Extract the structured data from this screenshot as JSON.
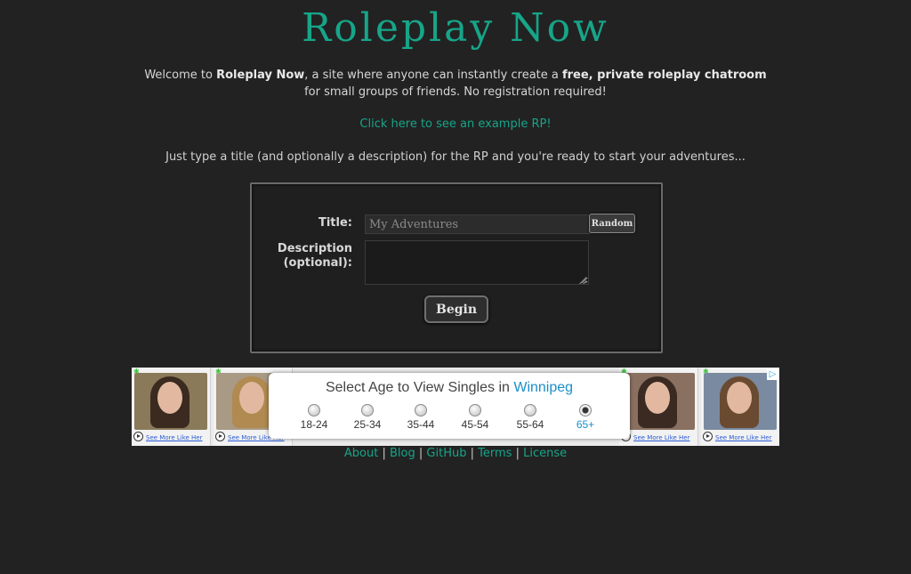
{
  "site": {
    "title": "Roleplay Now",
    "intro_part1": "Welcome to ",
    "intro_brand": "Roleplay Now",
    "intro_part2": ", a site where anyone can instantly create a ",
    "intro_bold": "free, private roleplay chatroom",
    "intro_line2": "for small groups of friends. No registration required!",
    "example_link": "Click here to see an example RP!",
    "instructions": "Just type a title (and optionally a description) for the RP and you're ready to start your adventures..."
  },
  "form": {
    "title_label": "Title:",
    "title_placeholder": "My Adventures",
    "title_value": "",
    "random_button": "Random",
    "description_label_line1": "Description",
    "description_label_line2": "(optional):",
    "description_value": "",
    "begin_button": "Begin"
  },
  "ad": {
    "headline_prefix": "Select Age to View Singles in ",
    "headline_city": "Winnipeg",
    "tile_link": "See More Like Her",
    "age_options": [
      "18-24",
      "25-34",
      "35-44",
      "45-54",
      "55-64",
      "65+"
    ],
    "selected_age": "65+",
    "accent_color": "#1a8fc9"
  },
  "footer": {
    "links": [
      "About",
      "Blog",
      "GitHub",
      "Terms",
      "License"
    ],
    "separator": "|"
  },
  "colors": {
    "background": "#222222",
    "accent": "#17a589",
    "text": "#d0d0d0"
  }
}
